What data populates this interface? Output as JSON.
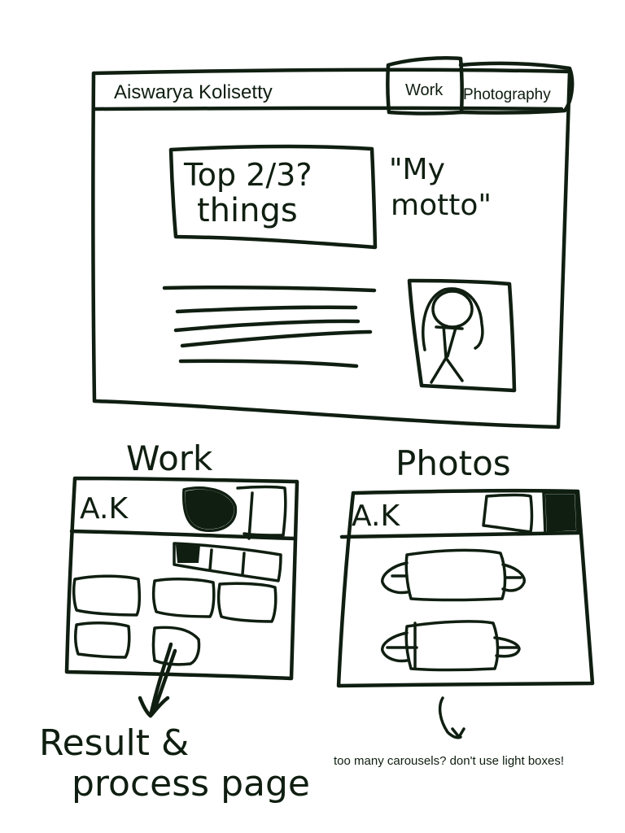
{
  "main_wireframe": {
    "site_title": "Aiswarya Kolisetty",
    "nav_work": "Work",
    "nav_photography": "Photography",
    "highlight_box_line1": "Top 2/3?",
    "highlight_box_line2": "things",
    "motto_line1": "\"My",
    "motto_line2": "motto\""
  },
  "work_wireframe": {
    "heading": "Work",
    "logo": "A.K",
    "annotation_line1": "Result &",
    "annotation_line2": "process page"
  },
  "photos_wireframe": {
    "heading": "Photos",
    "logo": "A.K",
    "note": "too many carousels? don't use light boxes!"
  },
  "ink_color": "#0f1e10"
}
